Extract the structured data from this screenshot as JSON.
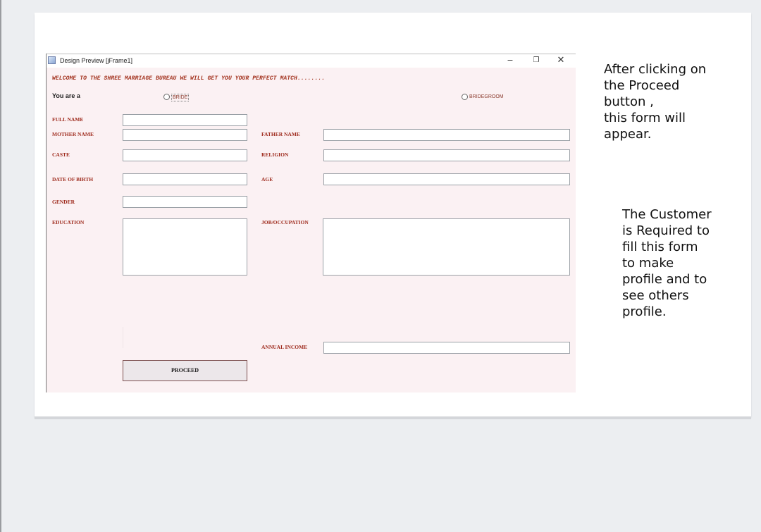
{
  "window": {
    "title": "Design Preview [jFrame1]",
    "minimize": "−",
    "restore": "❐",
    "close": "✕",
    "icon": "java-app-icon"
  },
  "form": {
    "welcome": "WELCOME TO THE SHREE MARRIAGE BUREAU WE WILL GET YOU YOUR PERFECT MATCH........",
    "you_are": "You are a",
    "options": {
      "bride": "BRIDE",
      "bridegroom": "BRIDEGROOM"
    },
    "labels": {
      "full_name": "FULL NAME",
      "mother_name": "MOTHER NAME",
      "father_name": "FATHER NAME",
      "caste": "CASTE",
      "religion": "RELIGION",
      "date_of_birth": "DATE OF BIRTH",
      "age": "AGE",
      "gender": "GENDER",
      "education": "EDUCATION",
      "job_occupation": "JOB/OCCUPATION",
      "annual_income": "ANNUAL INCOME"
    },
    "values": {
      "full_name": "",
      "mother_name": "",
      "father_name": "",
      "caste": "",
      "religion": "",
      "date_of_birth": "",
      "age": "",
      "gender": "",
      "education": "",
      "job_occupation": "",
      "annual_income": ""
    },
    "proceed": "PROCEED"
  },
  "notes": {
    "note1_lines": [
      "After clicking on",
      "the Proceed",
      "button ,",
      "this form will",
      "appear."
    ],
    "note2_lines": [
      "The Customer",
      "is Required to",
      "fill this form",
      "to make",
      "profile and to",
      "see others",
      "profile."
    ]
  },
  "colors": {
    "form_background": "#fbf1f3",
    "label_color": "#9e2a1c",
    "welcome_color": "#a3331f"
  }
}
